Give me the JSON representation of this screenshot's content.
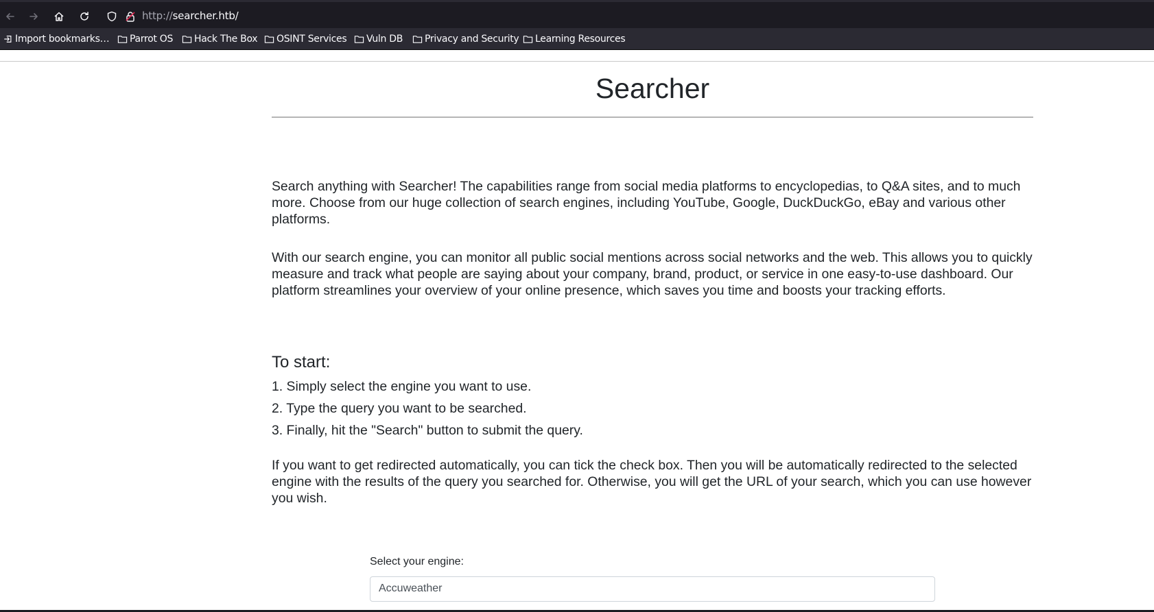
{
  "browser": {
    "url_scheme": "http://",
    "url_host": "searcher.htb/",
    "icons": [
      "back-arrow-icon",
      "forward-arrow-icon",
      "home-icon",
      "reload-icon",
      "shield-icon",
      "insecure-lock-icon"
    ],
    "bookmarks": [
      {
        "label": "Import bookmarks…",
        "icon": "import-icon"
      },
      {
        "label": "Parrot OS",
        "icon": "folder-icon"
      },
      {
        "label": "Hack The Box",
        "icon": "folder-icon"
      },
      {
        "label": "OSINT Services",
        "icon": "folder-icon"
      },
      {
        "label": "Vuln DB",
        "icon": "folder-icon"
      },
      {
        "label": "Privacy and Security",
        "icon": "folder-icon"
      },
      {
        "label": "Learning Resources",
        "icon": "folder-icon"
      }
    ]
  },
  "page": {
    "title": "Searcher",
    "intro_paragraphs": [
      "Search anything with Searcher! The capabilities range from social media platforms to encyclopedias, to Q&A sites, and to much more. Choose from our huge collection of search engines, including YouTube, Google, DuckDuckGo, eBay and various other platforms.",
      "With our search engine, you can monitor all public social mentions across social networks and the web. This allows you to quickly measure and track what people are saying about your company, brand, product, or service in one easy-to-use dashboard. Our platform streamlines your overview of your online presence, which saves you time and boosts your tracking efforts."
    ],
    "start_heading": "To start:",
    "steps": [
      "1. Simply select the engine you want to use.",
      "2. Type the query you want to be searched.",
      "3. Finally, hit the \"Search\" button to submit the query."
    ],
    "redirect_paragraph": "If you want to get redirected automatically, you can tick the check box. Then you will be automatically redirected to the selected engine with the results of the query you searched for. Otherwise, you will get the URL of your search, which you can use however you wish.",
    "engine_label": "Select your engine:",
    "engine_selected": "Accuweather"
  },
  "colors": {
    "chrome_dark": "#1c1b22",
    "chrome_bar": "#2b2a33",
    "text": "#212529"
  }
}
